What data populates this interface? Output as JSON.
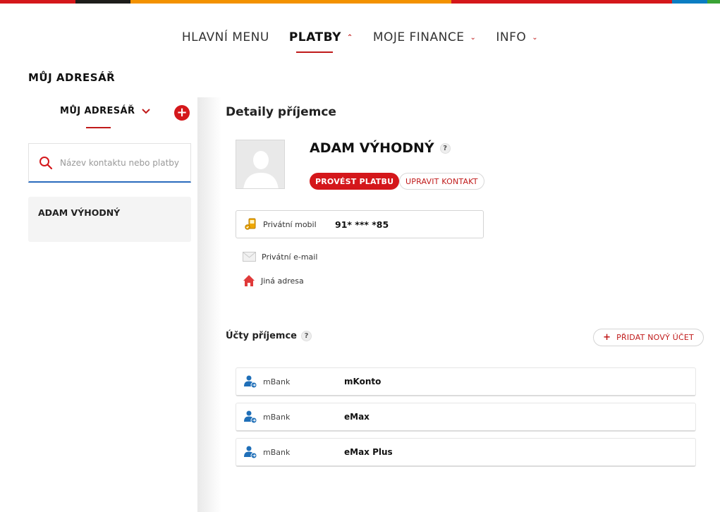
{
  "colors": {
    "stripe": [
      "#d4171b",
      "#1d1d1b",
      "#f39200",
      "#d4171b",
      "#0a7dc2",
      "#3aa335"
    ],
    "accent": "#d4171b",
    "input_underline": "#2a6bbd"
  },
  "topnav": {
    "items": [
      {
        "label": "HLAVNÍ MENU",
        "chevron": ""
      },
      {
        "label": "PLATBY",
        "chevron": "^"
      },
      {
        "label": "MOJE FINANCE",
        "chevron": "v"
      },
      {
        "label": "INFO",
        "chevron": "v"
      }
    ]
  },
  "page_title": "MŮJ ADRESÁŘ",
  "sidebar": {
    "header": "MŮJ ADRESÁŘ",
    "add_label": "+",
    "search_placeholder": "Název kontaktu nebo platby",
    "contacts": [
      "ADAM VÝHODNÝ"
    ]
  },
  "detail": {
    "title": "Detaily příjemce",
    "name": "ADAM VÝHODNÝ",
    "help": "?",
    "pay_label": "PROVÉST PLATBU",
    "edit_label": "UPRAVIT KONTAKT",
    "phone_label": "Privátní mobil",
    "phone_value": "91* *** *85",
    "email_label": "Privátní e-mail",
    "address_label": "Jiná adresa"
  },
  "accounts": {
    "title": "Účty příjemce",
    "help": "?",
    "add_label": "PŘIDAT NOVÝ ÚČET",
    "add_plus": "+",
    "rows": [
      {
        "bank": "mBank",
        "name": "mKonto"
      },
      {
        "bank": "mBank",
        "name": "eMax"
      },
      {
        "bank": "mBank",
        "name": "eMax Plus"
      }
    ]
  },
  "icons": {
    "search": "search-icon",
    "phone": "mobile-phone-icon",
    "email": "envelope-icon",
    "address": "house-icon",
    "account": "user-account-icon",
    "avatar": "person-silhouette-icon"
  }
}
